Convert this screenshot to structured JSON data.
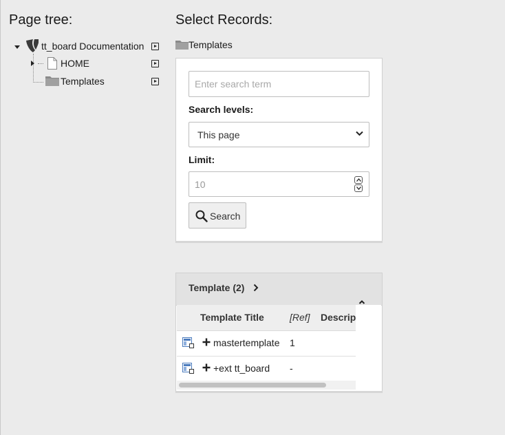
{
  "tree": {
    "heading": "Page tree:",
    "root": {
      "label": "tt_board Documentation"
    },
    "children": [
      {
        "label": "HOME"
      },
      {
        "label": "Templates"
      }
    ]
  },
  "records": {
    "heading": "Select Records:",
    "current_page": "Templates",
    "search": {
      "placeholder": "Enter search term",
      "levels_label": "Search levels:",
      "levels_value": "This page",
      "limit_label": "Limit:",
      "limit_value": "10",
      "button_label": "Search"
    },
    "table": {
      "title": "Template (2)",
      "columns": [
        "Template Title",
        "[Ref]",
        "Descrip"
      ],
      "rows": [
        {
          "title": "mastertemplate",
          "ref": "1"
        },
        {
          "title": "+ext tt_board",
          "ref": "-"
        }
      ]
    }
  }
}
